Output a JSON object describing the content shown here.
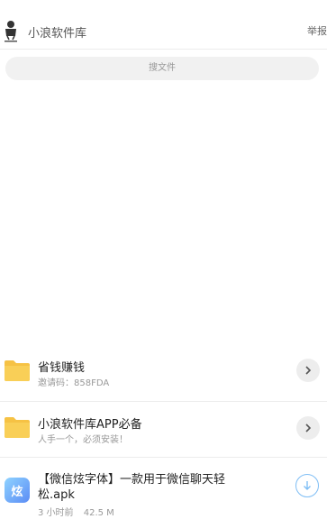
{
  "header": {
    "title": "小浪软件库",
    "report_label": "举报",
    "logo_icon": "app-logo-icon"
  },
  "search": {
    "placeholder": "搜文件"
  },
  "folders": [
    {
      "name": "省钱赚钱",
      "subtitle": "邀请码：858FDA",
      "icon": "folder-icon"
    },
    {
      "name": "小浪软件库APP必备",
      "subtitle": "人手一个，必须安装！",
      "icon": "folder-icon"
    }
  ],
  "file": {
    "name": "【微信炫字体】一款用于微信聊天轻松.apk",
    "time": "3 小时前",
    "size": "42.5 M",
    "icon": "apk-icon",
    "icon_char": "炫"
  },
  "colors": {
    "folder": "#f6c244",
    "download_accent": "#7fbef5",
    "search_bg": "#f1f1f1"
  }
}
